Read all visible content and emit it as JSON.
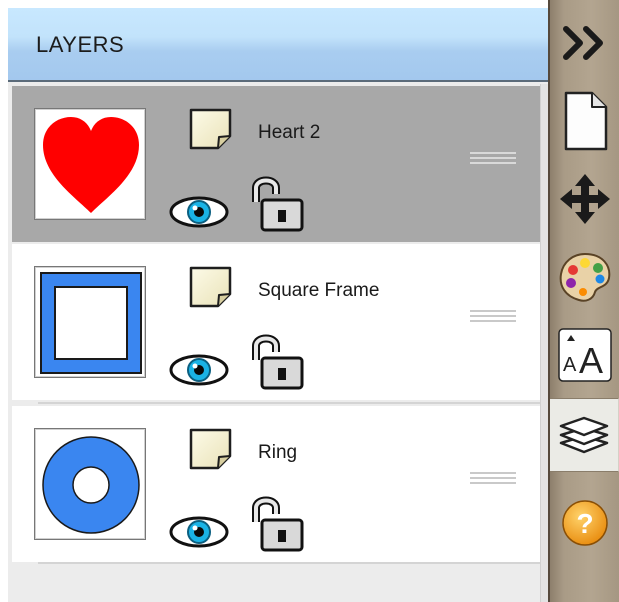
{
  "panel": {
    "title": "LAYERS"
  },
  "layers": [
    {
      "name": "Heart 2",
      "selected": true,
      "thumbnail": "heart",
      "color": "#ff0000",
      "visible": true,
      "locked": false
    },
    {
      "name": "Square Frame",
      "selected": false,
      "thumbnail": "square-frame",
      "color": "#3a86f0",
      "visible": true,
      "locked": false
    },
    {
      "name": "Ring",
      "selected": false,
      "thumbnail": "ring",
      "color": "#3a86f0",
      "visible": true,
      "locked": false
    }
  ],
  "toolbar": {
    "tools": [
      {
        "icon": "double-chevron-right-icon"
      },
      {
        "icon": "new-page-icon"
      },
      {
        "icon": "move-arrows-icon"
      },
      {
        "icon": "palette-icon"
      },
      {
        "icon": "text-size-icon"
      },
      {
        "icon": "layers-icon",
        "active": true
      },
      {
        "icon": "help-icon"
      }
    ]
  },
  "colors": {
    "header_blue": "#c2e3fb",
    "selected_row": "#a8a8a8",
    "toolbar_tan": "#b3a590",
    "shape_blue": "#3a86f0",
    "heart_red": "#ff0000",
    "help_orange": "#f2a11c"
  }
}
